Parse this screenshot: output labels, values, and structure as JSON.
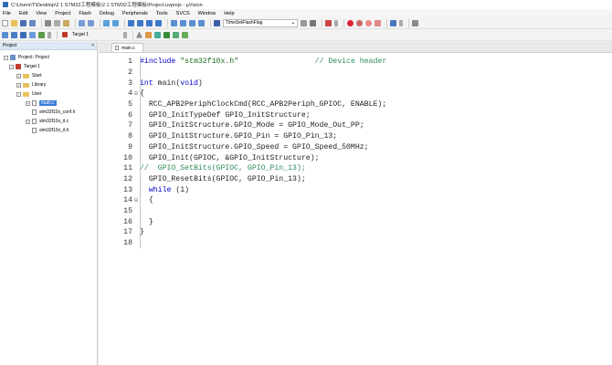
{
  "window": {
    "title": "C:\\Users\\T\\Desktop\\2 1 STM32工程模板\\2 1 STM32工程模板\\Project.uvprojx - µVision"
  },
  "menu": [
    "File",
    "Edit",
    "View",
    "Project",
    "Flash",
    "Debug",
    "Peripherals",
    "Tools",
    "SVCS",
    "Window",
    "Help"
  ],
  "toolbar1": {
    "find_combo": "TimeSetFlashFlag"
  },
  "toolbar2": {
    "target_combo": "Target 1"
  },
  "project_panel": {
    "header": "Project",
    "close_glyph": "×",
    "tree": [
      {
        "label": "Project: Project",
        "level": 0,
        "expander": "−",
        "icon": "proj"
      },
      {
        "label": "Target 1",
        "level": 1,
        "expander": "−",
        "icon": "target"
      },
      {
        "label": "Start",
        "level": 2,
        "expander": "+",
        "icon": "folder"
      },
      {
        "label": "Library",
        "level": 2,
        "expander": "+",
        "icon": "folder"
      },
      {
        "label": "User",
        "level": 2,
        "expander": "−",
        "icon": "folder"
      },
      {
        "label": "main.c",
        "level": 3,
        "expander": "+",
        "icon": "file",
        "selected": true
      },
      {
        "label": "stm32f10x_conf.h",
        "level": 3,
        "expander": "",
        "icon": "file"
      },
      {
        "label": "stm32f10x_it.c",
        "level": 3,
        "expander": "+",
        "icon": "file"
      },
      {
        "label": "stm32f10x_it.h",
        "level": 3,
        "expander": "",
        "icon": "file"
      }
    ]
  },
  "editor": {
    "tab_label": "main.c",
    "lines": [
      {
        "n": "1",
        "fold": "",
        "tokens": [
          {
            "t": "#include ",
            "c": "kw"
          },
          {
            "t": "\"stm32f10x.h\"",
            "c": "str"
          },
          {
            "t": "                 ",
            "c": ""
          },
          {
            "t": "// Device header",
            "c": "cmt"
          }
        ]
      },
      {
        "n": "2",
        "fold": "",
        "tokens": []
      },
      {
        "n": "3",
        "fold": "",
        "tokens": [
          {
            "t": "int",
            "c": "kw"
          },
          {
            "t": " main(",
            "c": ""
          },
          {
            "t": "void",
            "c": "kw"
          },
          {
            "t": ")",
            "c": ""
          }
        ]
      },
      {
        "n": "4",
        "fold": "⊟",
        "tokens": [
          {
            "t": "{",
            "c": ""
          }
        ]
      },
      {
        "n": "5",
        "fold": "",
        "tokens": [
          {
            "t": "  RCC_APB2PeriphClockCmd(RCC_APB2Periph_GPIOC, ENABLE);",
            "c": ""
          }
        ]
      },
      {
        "n": "6",
        "fold": "",
        "tokens": [
          {
            "t": "  GPIO_InitTypeDef GPIO_InitStructure;",
            "c": ""
          }
        ]
      },
      {
        "n": "7",
        "fold": "",
        "tokens": [
          {
            "t": "  GPIO_InitStructure.GPIO_Mode = GPIO_Mode_Out_PP;",
            "c": ""
          }
        ]
      },
      {
        "n": "8",
        "fold": "",
        "tokens": [
          {
            "t": "  GPIO_InitStructure.GPIO_Pin = GPIO_Pin_13;",
            "c": ""
          }
        ]
      },
      {
        "n": "9",
        "fold": "",
        "tokens": [
          {
            "t": "  GPIO_InitStructure.GPIO_Speed = GPIO_Speed_50MHz;",
            "c": ""
          }
        ]
      },
      {
        "n": "10",
        "fold": "",
        "tokens": [
          {
            "t": "  GPIO_Init(GPIOC, &GPIO_InitStructure);",
            "c": ""
          }
        ]
      },
      {
        "n": "11",
        "fold": "",
        "tokens": [
          {
            "t": "//  GPIO_SetBits(GPIOC, GPIO_Pin_13);",
            "c": "cmt"
          }
        ]
      },
      {
        "n": "12",
        "fold": "",
        "tokens": [
          {
            "t": "  GPIO_ResetBits(GPIOC, GPIO_Pin_13);",
            "c": ""
          }
        ]
      },
      {
        "n": "13",
        "fold": "",
        "tokens": [
          {
            "t": "  ",
            "c": ""
          },
          {
            "t": "while",
            "c": "kw"
          },
          {
            "t": " (1)",
            "c": ""
          }
        ]
      },
      {
        "n": "14",
        "fold": "⊟",
        "tokens": [
          {
            "t": "  {",
            "c": ""
          }
        ]
      },
      {
        "n": "15",
        "fold": "",
        "tokens": []
      },
      {
        "n": "16",
        "fold": "",
        "tokens": [
          {
            "t": "  }",
            "c": ""
          }
        ]
      },
      {
        "n": "17",
        "fold": "",
        "tokens": [
          {
            "t": "}",
            "c": ""
          }
        ]
      },
      {
        "n": "18",
        "fold": "",
        "tokens": []
      }
    ]
  },
  "colors": {
    "keyword": "#0000cc",
    "string": "#1a6a1a",
    "comment": "#2e8b57",
    "selection": "#3d7bd9"
  }
}
